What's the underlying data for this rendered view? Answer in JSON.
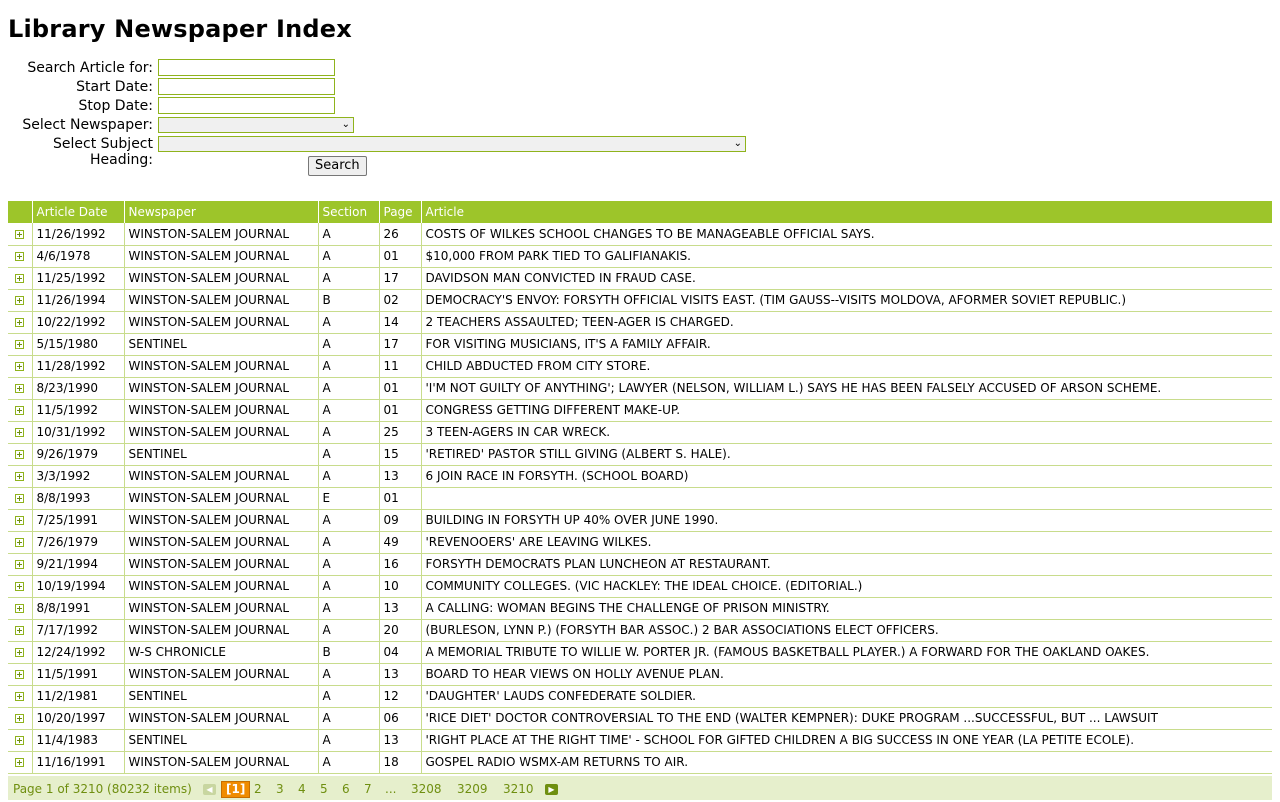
{
  "page_title": "Library Newspaper Index",
  "form": {
    "search_label": "Search Article for:",
    "start_label": "Start Date:",
    "stop_label": "Stop Date:",
    "newspaper_label": "Select Newspaper:",
    "subject_label": "Select Subject Heading:",
    "search_value": "",
    "start_value": "",
    "stop_value": "",
    "newspaper_value": "",
    "subject_value": "",
    "search_button": "Search"
  },
  "table": {
    "headers": [
      "Article Date",
      "Newspaper",
      "Section",
      "Page",
      "Article"
    ],
    "rows": [
      [
        "11/26/1992",
        "WINSTON-SALEM JOURNAL",
        "A",
        "26",
        "COSTS OF WILKES SCHOOL CHANGES TO BE MANAGEABLE OFFICIAL SAYS."
      ],
      [
        "4/6/1978",
        "WINSTON-SALEM JOURNAL",
        "A",
        "01",
        "$10,000 FROM PARK TIED TO GALIFIANAKIS."
      ],
      [
        "11/25/1992",
        "WINSTON-SALEM JOURNAL",
        "A",
        "17",
        "DAVIDSON MAN CONVICTED IN FRAUD CASE."
      ],
      [
        "11/26/1994",
        "WINSTON-SALEM JOURNAL",
        "B",
        "02",
        "DEMOCRACY'S ENVOY: FORSYTH OFFICIAL VISITS EAST. (TIM GAUSS--VISITS MOLDOVA, AFORMER SOVIET REPUBLIC.)"
      ],
      [
        "10/22/1992",
        "WINSTON-SALEM JOURNAL",
        "A",
        "14",
        "2 TEACHERS ASSAULTED; TEEN-AGER IS CHARGED."
      ],
      [
        "5/15/1980",
        "SENTINEL",
        "A",
        "17",
        "FOR VISITING MUSICIANS, IT'S A FAMILY AFFAIR."
      ],
      [
        "11/28/1992",
        "WINSTON-SALEM JOURNAL",
        "A",
        "11",
        "CHILD ABDUCTED FROM CITY STORE."
      ],
      [
        "8/23/1990",
        "WINSTON-SALEM JOURNAL",
        "A",
        "01",
        "'I'M NOT GUILTY OF ANYTHING'; LAWYER (NELSON, WILLIAM L.) SAYS HE HAS BEEN FALSELY ACCUSED OF ARSON SCHEME."
      ],
      [
        "11/5/1992",
        "WINSTON-SALEM JOURNAL",
        "A",
        "01",
        "CONGRESS GETTING DIFFERENT MAKE-UP."
      ],
      [
        "10/31/1992",
        "WINSTON-SALEM JOURNAL",
        "A",
        "25",
        "3 TEEN-AGERS IN CAR WRECK."
      ],
      [
        "9/26/1979",
        "SENTINEL",
        "A",
        "15",
        "'RETIRED' PASTOR STILL GIVING (ALBERT S. HALE)."
      ],
      [
        "3/3/1992",
        "WINSTON-SALEM JOURNAL",
        "A",
        "13",
        "6 JOIN RACE IN FORSYTH. (SCHOOL BOARD)"
      ],
      [
        "8/8/1993",
        "WINSTON-SALEM JOURNAL",
        "E",
        "01",
        ""
      ],
      [
        "7/25/1991",
        "WINSTON-SALEM JOURNAL",
        "A",
        "09",
        "BUILDING IN FORSYTH UP 40% OVER JUNE 1990."
      ],
      [
        "7/26/1979",
        "WINSTON-SALEM JOURNAL",
        "A",
        "49",
        "'REVENOOERS' ARE LEAVING WILKES."
      ],
      [
        "9/21/1994",
        "WINSTON-SALEM JOURNAL",
        "A",
        "16",
        "FORSYTH DEMOCRATS PLAN LUNCHEON AT RESTAURANT."
      ],
      [
        "10/19/1994",
        "WINSTON-SALEM JOURNAL",
        "A",
        "10",
        "COMMUNITY COLLEGES. (VIC HACKLEY: THE IDEAL CHOICE. (EDITORIAL.)"
      ],
      [
        "8/8/1991",
        "WINSTON-SALEM JOURNAL",
        "A",
        "13",
        "A CALLING: WOMAN BEGINS THE CHALLENGE OF PRISON MINISTRY."
      ],
      [
        "7/17/1992",
        "WINSTON-SALEM JOURNAL",
        "A",
        "20",
        "(BURLESON, LYNN P.) (FORSYTH BAR ASSOC.) 2 BAR ASSOCIATIONS ELECT OFFICERS."
      ],
      [
        "12/24/1992",
        "W-S CHRONICLE",
        "B",
        "04",
        "A MEMORIAL TRIBUTE TO WILLIE W. PORTER JR. (FAMOUS BASKETBALL PLAYER.) A FORWARD FOR THE OAKLAND OAKES."
      ],
      [
        "11/5/1991",
        "WINSTON-SALEM JOURNAL",
        "A",
        "13",
        "BOARD TO HEAR VIEWS ON HOLLY AVENUE PLAN."
      ],
      [
        "11/2/1981",
        "SENTINEL",
        "A",
        "12",
        "'DAUGHTER' LAUDS CONFEDERATE SOLDIER."
      ],
      [
        "10/20/1997",
        "WINSTON-SALEM JOURNAL",
        "A",
        "06",
        "'RICE DIET' DOCTOR CONTROVERSIAL TO THE END (WALTER KEMPNER): DUKE PROGRAM ...SUCCESSFUL, BUT ... LAWSUIT"
      ],
      [
        "11/4/1983",
        "SENTINEL",
        "A",
        "13",
        "'RIGHT PLACE AT THE RIGHT TIME' - SCHOOL FOR GIFTED CHILDREN A BIG SUCCESS IN ONE YEAR (LA PETITE ECOLE)."
      ],
      [
        "11/16/1991",
        "WINSTON-SALEM JOURNAL",
        "A",
        "18",
        "GOSPEL RADIO WSMX-AM RETURNS TO AIR."
      ]
    ]
  },
  "pager": {
    "info": "Page 1 of 3210 (80232 items)",
    "current": "[1]",
    "pages": [
      "2",
      "3",
      "4",
      "5",
      "6",
      "7",
      "...",
      "3208",
      "3209",
      "3210"
    ],
    "prev_icon": "arrow-left-icon",
    "next_icon": "arrow-right-icon"
  },
  "colors": {
    "header_green": "#9dc52a",
    "pager_bg": "#e6efcc",
    "current_page": "#f08c00"
  }
}
